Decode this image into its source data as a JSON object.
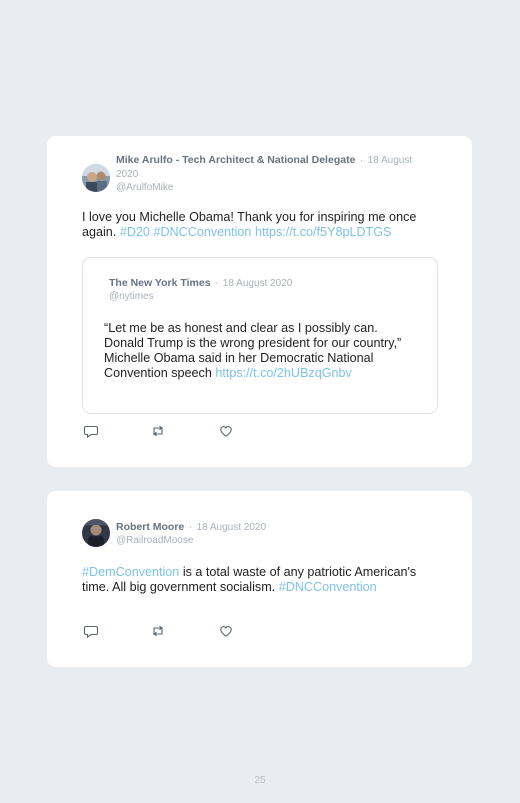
{
  "tweets": [
    {
      "author": "Mike Arulfo - Tech Architect & National Delegate",
      "separator": "·",
      "date": "18 August 2020",
      "handle": "@ArulfoMike",
      "text": "I love you Michelle Obama! Thank you for inspiring me once again.",
      "hashtags": [
        "#D20",
        "#DNCConvention"
      ],
      "link": "https://t.co/f5Y8pLDTGS",
      "quote": {
        "author": "The New York Times",
        "separator": "·",
        "date": "18 August 2020",
        "handle": "@nytimes",
        "text": "“Let me be as honest and clear as I possibly can. Donald Trump is the wrong president for our country,” Michelle Obama said in her Democratic National Convention speech",
        "link": "https://t.co/2hUBzqGnbv"
      }
    },
    {
      "author": "Robert Moore",
      "separator": "·",
      "date": "18 August 2020",
      "handle": "@RailroadMoose",
      "hashtag_lead": "#DemConvention",
      "text": "is a total waste of any patriotic American's time. All big government socialism.",
      "hashtag_tail": "#DNCConvention"
    }
  ],
  "icons": {
    "reply": "reply-icon",
    "retweet": "retweet-icon",
    "like": "heart-icon"
  },
  "colors": {
    "link": "#7dc3e6",
    "name": "#657382",
    "muted": "#a8b1bb",
    "page_bg": "#e9ecf0"
  },
  "page_number": "25"
}
